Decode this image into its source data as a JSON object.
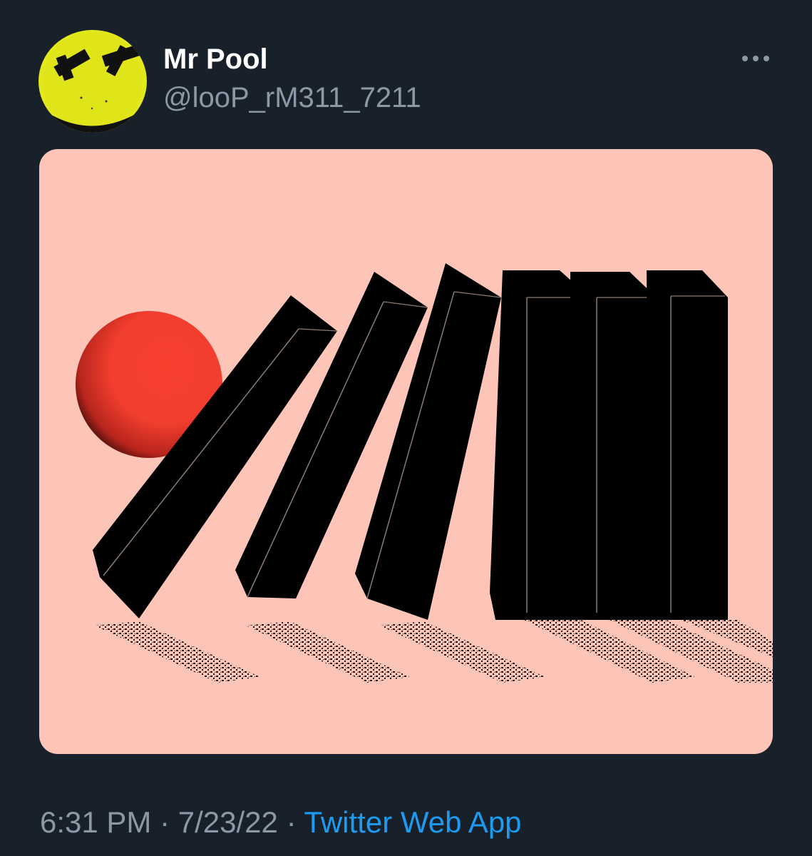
{
  "tweet": {
    "display_name": "Mr Pool",
    "handle": "@looP_rM311_7211",
    "time": "6:31 PM",
    "separator": "·",
    "date": "7/23/22",
    "source": "Twitter Web App"
  },
  "icons": {
    "more": "more-horizontal-icon",
    "avatar": "yellow-face-with-taped-x-eyes"
  },
  "colors": {
    "background": "#18202a",
    "name_text": "#ffffff",
    "secondary_text": "#8b98a5",
    "link": "#1d9bf0",
    "media_background": "#fdc4b8",
    "ball": "#f23e2e",
    "dominoes": "#000000",
    "avatar_face": "#e3e81c"
  }
}
